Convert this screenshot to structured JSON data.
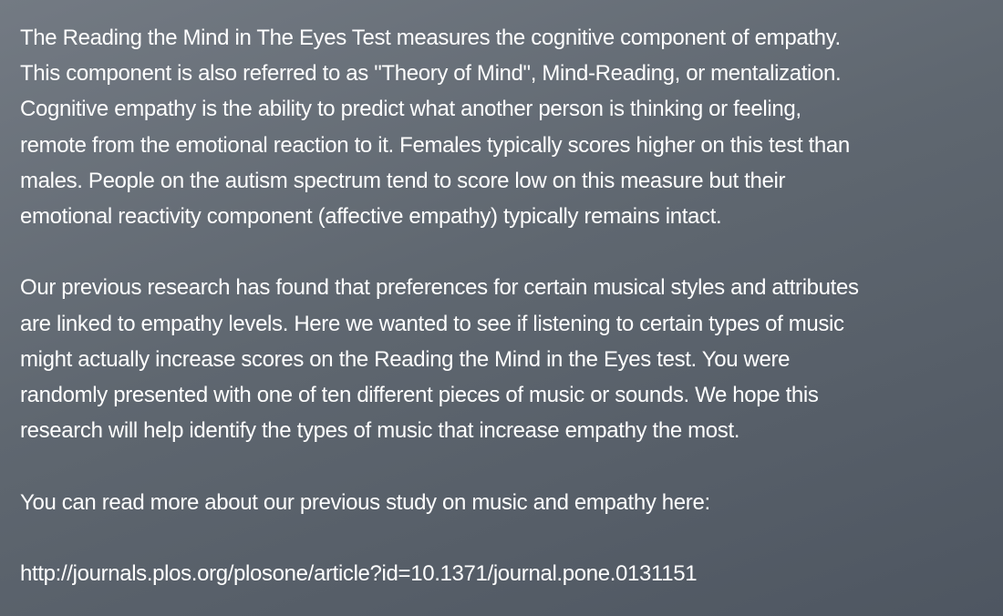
{
  "paragraphs": [
    {
      "lines": [
        "The Reading the Mind in The Eyes Test measures the cognitive component of empathy.",
        "This component is also referred to as \"Theory of Mind\", Mind-Reading, or mentalization.",
        "Cognitive empathy is the ability to predict what another person is thinking or feeling,",
        "remote from the emotional reaction to it. Females typically scores higher on this test than",
        "males. People on the autism spectrum tend to score low on this measure but their",
        "emotional reactivity component (affective empathy) typically remains intact."
      ]
    },
    {
      "lines": [
        "Our previous research has found that preferences for certain musical styles and attributes",
        "are linked to empathy levels. Here we wanted to see if listening to certain types of music",
        "might actually increase scores on the Reading the Mind in the Eyes test. You were",
        "randomly presented with one of ten different pieces of music or sounds. We hope this",
        "research will help identify the types of music that increase empathy the most."
      ]
    },
    {
      "lines": [
        "You can read more about our previous study on music and empathy here:"
      ]
    }
  ],
  "link": {
    "text": "http://journals.plos.org/plosone/article?id=10.1371/journal.pone.0131151"
  }
}
